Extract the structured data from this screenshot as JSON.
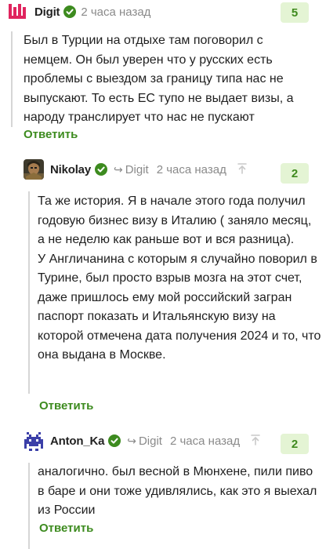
{
  "comments": [
    {
      "username": "Digit",
      "reply_to": "",
      "time": "2 часа назад",
      "rating": "5",
      "text": "Был в Турции на отдыхе там поговорил с немцем. Он был уверен что у русских есть проблемы с выездом за границу типа нас не выпускают. То есть ЕС тупо не выдает визы, а народу транслирует что нас не пускают",
      "reply_label": "Ответить"
    },
    {
      "username": "Nikolay",
      "reply_to": "Digit",
      "time": "2 часа назад",
      "rating": "2",
      "text": "Та же история. Я в начале этого года получил годовую бизнес визу в Италию ( заняло месяц, а не неделю как раньше вот и вся разница).\nУ Англичанина с которым я случайно поворил в Турине, был просто взрыв мозга на этот счет, даже пришлось ему мой российский загран паспорт показать и Итальянскую визу на которой отмечена дата получения 2024 и то, что она выдана в Москве.",
      "reply_label": "Ответить"
    },
    {
      "username": "Anton_Ka",
      "reply_to": "Digit",
      "time": "2 часа назад",
      "rating": "2",
      "text": "аналогично. был весной в Мюнхене, пили пиво в баре и они тоже удивлялись, как это я выехал из России",
      "reply_label": "Ответить"
    }
  ],
  "colors": {
    "accent": "#3d8b1f",
    "rating_bg": "#e4f4d4",
    "verified": "#3d8b1f",
    "meta": "#8a8a8a"
  },
  "icons": {
    "verified": "verified-check-icon",
    "reply_to": "reply-arrow-icon",
    "parent": "arrow-up-icon"
  }
}
